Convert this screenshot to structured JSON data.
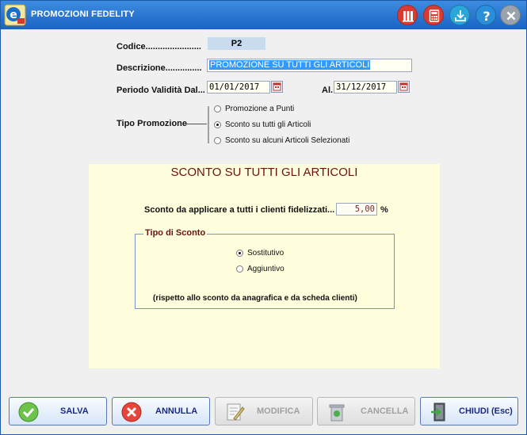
{
  "window": {
    "title": "PROMOZIONI FEDELITY",
    "accent": "#1a63c4"
  },
  "toolbar": {
    "icons": [
      "archive-icon",
      "calculator-icon",
      "download-icon",
      "help-icon",
      "close-icon"
    ]
  },
  "form": {
    "codice_label": "Codice.......................",
    "codice_value": "P2",
    "descrizione_label": "Descrizione...............",
    "descrizione_value": "PROMOZIONE SU TUTTI GLI ARTICOLI",
    "periodo_label": "Periodo Validità Dal...",
    "dal_value": "01/01/2017",
    "al_label": "Al.",
    "al_value": "31/12/2017",
    "tipo_label": "Tipo Promozione",
    "tipo_options": [
      "Promozione a Punti",
      "Sconto su tutti gli Articoli",
      "Sconto su alcuni Articoli Selezionati"
    ],
    "tipo_selected": 1
  },
  "panel": {
    "title": "SCONTO SU TUTTI GLI ARTICOLI",
    "sconto_label": "Sconto da applicare a tutti i clienti fidelizzati...",
    "sconto_value": "5,00",
    "sconto_unit": "%",
    "group_title": "Tipo di Sconto",
    "options": [
      "Sostitutivo",
      "Aggiuntivo"
    ],
    "selected": 0,
    "note": "(rispetto allo sconto da anagrafica e da scheda clienti)"
  },
  "buttons": {
    "salva": "SALVA",
    "annulla": "ANNULLA",
    "modifica": "MODIFICA",
    "cancella": "CANCELLA",
    "chiudi": "CHIUDI (Esc)"
  }
}
